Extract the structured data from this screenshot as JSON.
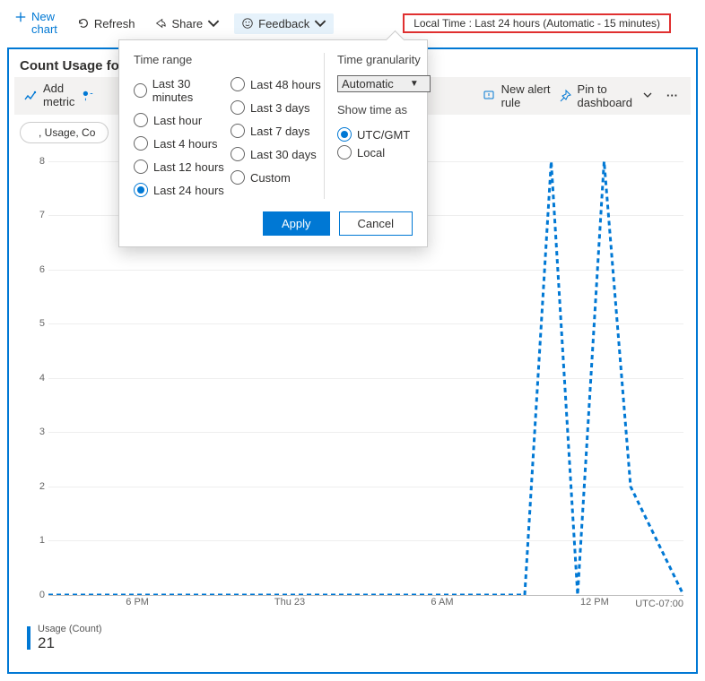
{
  "toolbar": {
    "new_chart_line1": "New",
    "new_chart_line2": "chart",
    "refresh": "Refresh",
    "share": "Share",
    "feedback": "Feedback",
    "time_pill": "Local Time : Last 24 hours (Automatic - 15 minutes)"
  },
  "panel": {
    "title_prefix": "Count Usage for",
    "add_metric_line1": "Add",
    "add_metric_line2": "metric",
    "new_alert_line1": "New alert",
    "new_alert_line2": "rule",
    "pin_line1": "Pin to",
    "pin_line2": "dashboard",
    "chip_text": ", Usage, Co"
  },
  "popover": {
    "time_range_label": "Time range",
    "range_options_left": [
      "Last 30 minutes",
      "Last hour",
      "Last 4 hours",
      "Last 12 hours",
      "Last 24 hours"
    ],
    "range_options_right": [
      "Last 48 hours",
      "Last 3 days",
      "Last 7 days",
      "Last 30 days",
      "Custom"
    ],
    "range_selected": "Last 24 hours",
    "granularity_label": "Time granularity",
    "granularity_value": "Automatic",
    "show_time_label": "Show time as",
    "show_time_options": [
      "UTC/GMT",
      "Local"
    ],
    "show_time_selected": "UTC/GMT",
    "apply": "Apply",
    "cancel": "Cancel"
  },
  "legend": {
    "label": "Usage (Count)",
    "value": "21"
  },
  "chart_data": {
    "type": "line",
    "title": "Count Usage",
    "ylabel": "Usage (Count)",
    "ylim": [
      0,
      8.2
    ],
    "yticks": [
      0,
      1,
      2,
      3,
      4,
      5,
      6,
      7,
      8
    ],
    "xlabel": "",
    "x_tick_labels": [
      "6 PM",
      "Thu 23",
      "6 AM",
      "12 PM"
    ],
    "x_tick_positions_pct": [
      14,
      38,
      62,
      86
    ],
    "timezone": "UTC-07:00",
    "x_hours": [
      0,
      1,
      2,
      3,
      4,
      5,
      6,
      7,
      8,
      9,
      10,
      11,
      12,
      13,
      14,
      15,
      16,
      17,
      18,
      19,
      20,
      21,
      22,
      23,
      24
    ],
    "values": [
      0,
      0,
      0,
      0,
      0,
      0,
      0,
      0,
      0,
      0,
      0,
      0,
      0,
      0,
      0,
      0,
      0,
      0,
      0,
      8,
      0,
      8,
      2,
      1,
      0
    ],
    "series": [
      {
        "name": "Usage (Count)"
      }
    ]
  },
  "colors": {
    "accent": "#0078d4",
    "highlight_border": "#e03030"
  }
}
